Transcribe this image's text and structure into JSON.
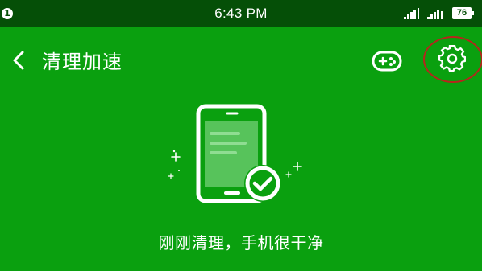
{
  "status_bar": {
    "notification_count": "1",
    "time": "6:43 PM",
    "battery_level": "76"
  },
  "toolbar": {
    "title": "清理加速",
    "back_icon": "chevron-left-icon",
    "game_icon": "gamepad-icon",
    "settings_icon": "gear-icon"
  },
  "main": {
    "status_message": "刚刚清理，手机很干净",
    "illustration_icon": "phone-check-icon"
  },
  "colors": {
    "background": "#0aa00f",
    "status_bar": "#054f07",
    "highlight_ring": "#b5261c"
  }
}
